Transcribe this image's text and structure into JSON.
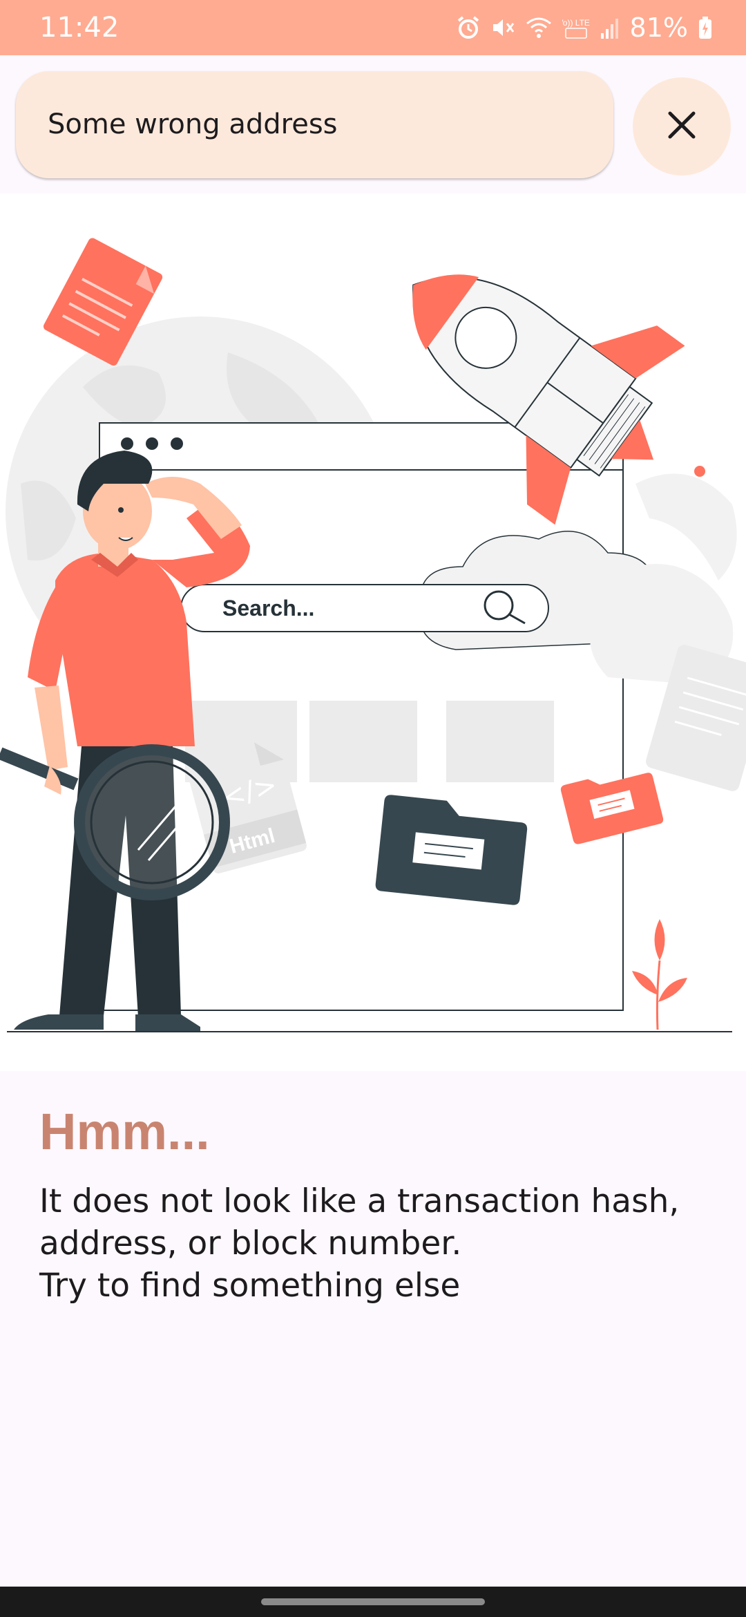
{
  "status_bar": {
    "time": "11:42",
    "network_label": "Vo)) LTE1",
    "battery": "81%",
    "icons": [
      "alarm-icon",
      "mute-icon",
      "wifi-icon",
      "lte-icon",
      "signal-icon",
      "battery-icon"
    ]
  },
  "search": {
    "value": "Some wrong address",
    "close_icon": "close-icon"
  },
  "illustration": {
    "search_text": "Search...",
    "file_label": "Html",
    "code_tag": "</>"
  },
  "message": {
    "title": "Hmm...",
    "body": "It does not look like a transaction hash,\naddress, or block number.\nTry to find something else"
  },
  "colors": {
    "status_bar": "#ffab91",
    "search_bg": "#fde9db",
    "page_bg": "#fdf8fd",
    "accent": "#ff725e",
    "dark": "#263238",
    "title": "#c98470"
  }
}
